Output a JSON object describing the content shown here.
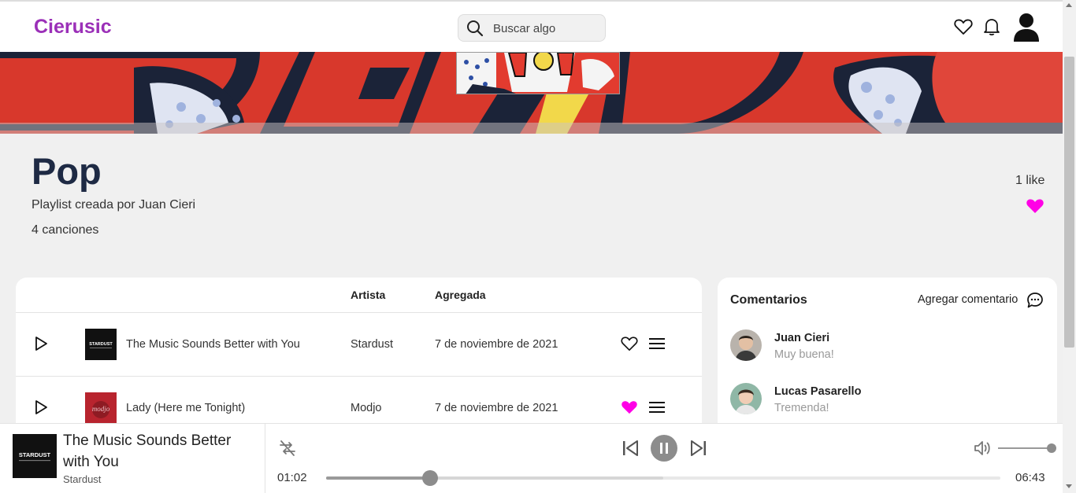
{
  "header": {
    "brand": "Cierusic",
    "search_placeholder": "Buscar algo"
  },
  "playlist": {
    "title": "Pop",
    "created_by": "Playlist creada por Juan Cieri",
    "song_count": "4 canciones",
    "likes": "1 like",
    "liked": true
  },
  "table": {
    "headers": {
      "artist": "Artista",
      "added": "Agregada"
    },
    "rows": [
      {
        "title": "The Music Sounds Better with You",
        "artist": "Stardust",
        "added": "7 de noviembre de 2021",
        "liked": false
      },
      {
        "title": "Lady (Here me Tonight)",
        "artist": "Modjo",
        "added": "7 de noviembre de 2021",
        "liked": true
      }
    ]
  },
  "comments": {
    "title": "Comentarios",
    "add_label": "Agregar comentario",
    "items": [
      {
        "name": "Juan Cieri",
        "text": "Muy buena!"
      },
      {
        "name": "Lucas Pasarello",
        "text": "Tremenda!"
      }
    ]
  },
  "player": {
    "title": "The Music Sounds Better with You",
    "artist": "Stardust",
    "current_time": "01:02",
    "total_time": "06:43",
    "progress": 0.154,
    "buffered": 0.5,
    "volume": 1.0
  },
  "colors": {
    "brand": "#9b30b8",
    "liked_heart": "#ff00e6",
    "title_text": "#1e2a44"
  }
}
